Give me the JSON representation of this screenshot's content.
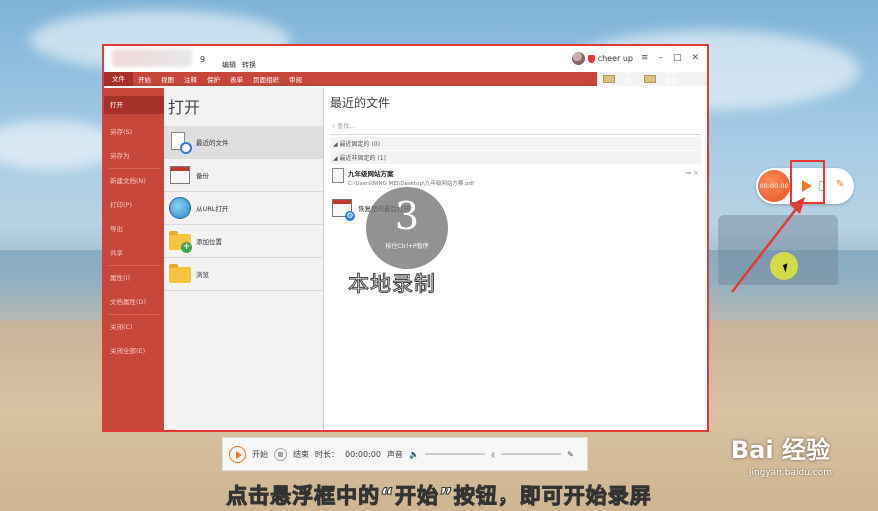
{
  "window": {
    "title_num": "9",
    "title_menus": [
      "编辑",
      "转换"
    ],
    "user_name": "cheer up",
    "ribbon_tabs": [
      "文件",
      "开始",
      "视图",
      "注释",
      "保护",
      "表单",
      "页面组织",
      "审阅"
    ],
    "ribbon_right": [
      "查找(F)",
      "高级查找(S)"
    ],
    "sidebar": [
      "打开",
      "另存(S)",
      "另存为",
      "新建文档(N)",
      "打印(P)",
      "导出",
      "共享",
      "属性(I)",
      "文档属性(D)",
      "关闭(C)",
      "关闭全部(E)"
    ],
    "open_title": "打开",
    "open_options": [
      "最近的文件",
      "备份",
      "从URL打开",
      "添加位置",
      "浏览"
    ],
    "recent_title": "最近的文件",
    "search_placeholder": "查找...",
    "group_pinned": "最近固定的 (0)",
    "group_unpinned": "最近非固定的 (1)",
    "file_name": "九年级网站方案",
    "file_path": "C:\\Users\\NING MEI\\Desktop\\九年级网站方案.pdf",
    "recover_label": "恢复您的最后打开"
  },
  "overlay": {
    "countdown": "3",
    "hotkey_hint": "按住Ctrl+P暂停",
    "mode_label": "本地录制"
  },
  "float_widget": {
    "timer": "00:00:00"
  },
  "toolbar": {
    "start": "开始",
    "stop": "结束",
    "duration_label": "时长：",
    "duration": "00:00:00",
    "sound": "声音"
  },
  "caption": "点击悬浮框中的“开始”按钮，即可开始录屏",
  "watermark": "Bai 经验",
  "watermark_url": "jingyan.baidu.com"
}
